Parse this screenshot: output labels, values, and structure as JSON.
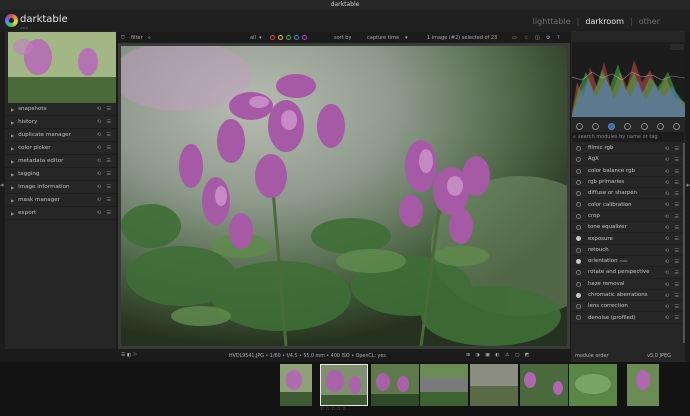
{
  "window": {
    "title": "darktable"
  },
  "brand": {
    "name": "darktable",
    "version": "3.8.0"
  },
  "views": {
    "lighttable": "lighttable",
    "darkroom": "darkroom",
    "other": "other",
    "separator": "|"
  },
  "left_panel": {
    "modules": [
      "snapshots",
      "history",
      "duplicate manager",
      "color picker",
      "metadata editor",
      "tagging",
      "image information",
      "mask manager",
      "export"
    ]
  },
  "topbar": {
    "filter_label": "filter",
    "sort_label": "sort by",
    "sort_value": "capture time",
    "all_label": "all",
    "status": "1 image (#2) selected of 23",
    "color_labels": [
      "#e04040",
      "#e0c040",
      "#40b040",
      "#4080e0",
      "#c040c0"
    ]
  },
  "image_info": "HVDL9541.JPG • 1/60 • f/4.5 • 55.0 mm • 400 ISO • OpenCL: yes",
  "right_panel": {
    "search_placeholder": "search modules by name or tag",
    "modules": [
      {
        "label": "filmic rgb",
        "on": false
      },
      {
        "label": "AgX",
        "on": false
      },
      {
        "label": "color balance rgb",
        "on": false
      },
      {
        "label": "rgb primaries",
        "on": false
      },
      {
        "label": "diffuse or sharpen",
        "on": false
      },
      {
        "label": "color calibration",
        "on": false
      },
      {
        "label": "crop",
        "on": false
      },
      {
        "label": "tone equalizer",
        "on": false
      },
      {
        "label": "exposure",
        "on": true
      },
      {
        "label": "retouch",
        "on": false
      },
      {
        "label": "orientation",
        "on": true,
        "tag": "auto"
      },
      {
        "label": "rotate and perspective",
        "on": false
      },
      {
        "label": "haze removal",
        "on": false
      },
      {
        "label": "chromatic aberrations",
        "on": true
      },
      {
        "label": "lens correction",
        "on": false
      },
      {
        "label": "denoise (profiled)",
        "on": false
      }
    ],
    "footer_label": "module order",
    "footer_value": "v5.0 JPEG"
  },
  "filmstrip": {
    "stars": "☆☆☆☆☆"
  },
  "colors": {
    "accent": "#4e8ac6",
    "bg": "#1b1b1b",
    "panel": "#262626"
  }
}
